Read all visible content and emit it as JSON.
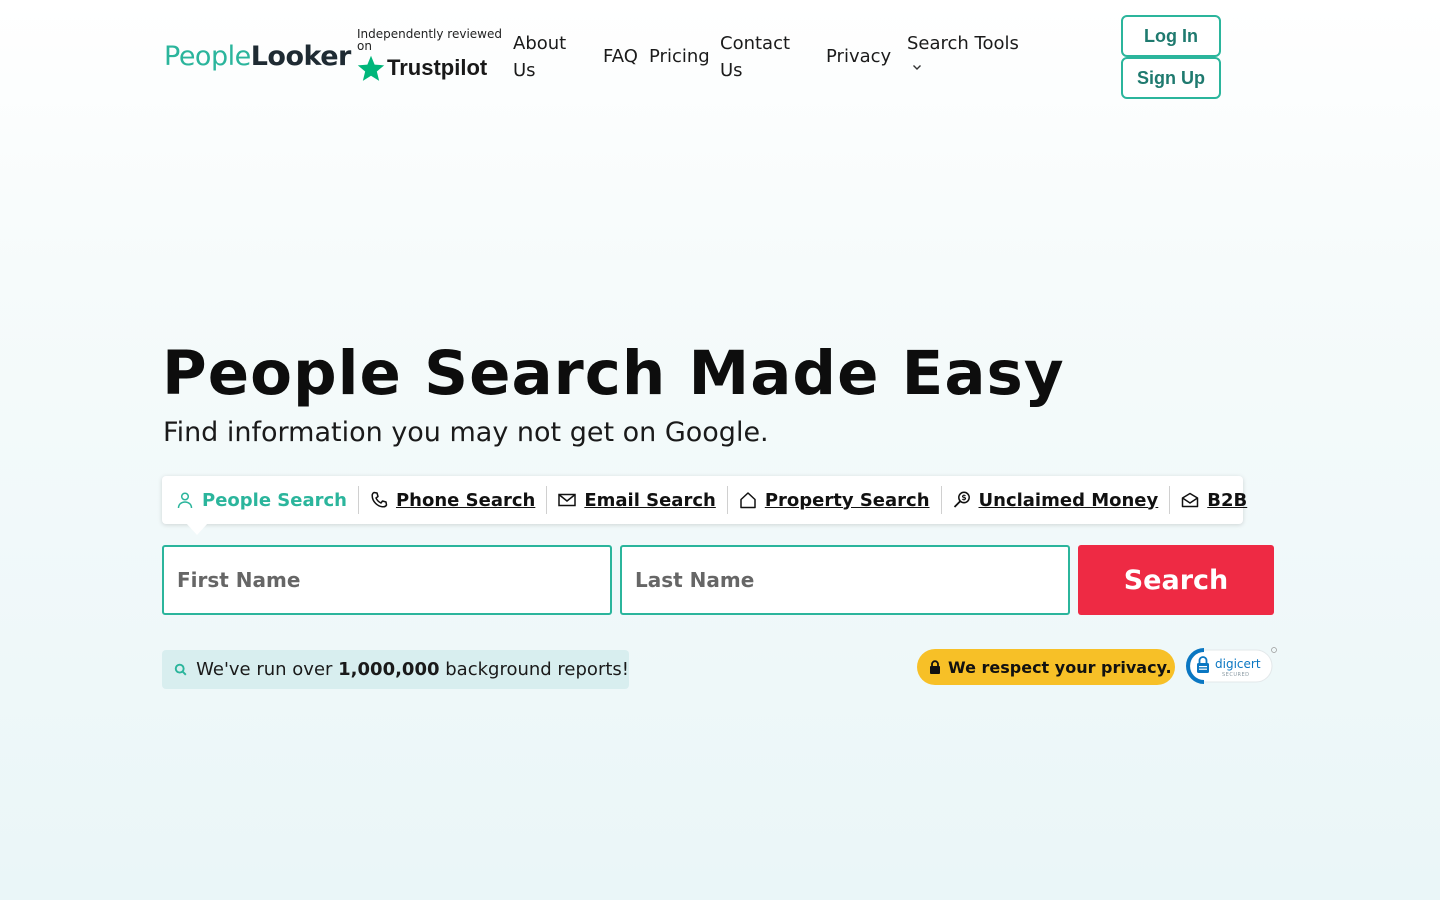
{
  "header": {
    "logo": {
      "part1": "People",
      "part2": "Looker"
    },
    "trustpilot": {
      "reviewed_text": "Independently reviewed on",
      "brand": "Trustpilot"
    },
    "nav": {
      "about": "About Us",
      "faq": "FAQ",
      "pricing": "Pricing",
      "contact": "Contact Us",
      "privacy": "Privacy",
      "search_tools": "Search Tools"
    },
    "login": "Log In",
    "signup": "Sign Up"
  },
  "hero": {
    "title": "People Search Made Easy",
    "subtitle": "Find information you may not get on Google."
  },
  "tabs": [
    {
      "label": "People Search",
      "icon": "person-icon",
      "active": true
    },
    {
      "label": "Phone Search",
      "icon": "phone-icon",
      "active": false
    },
    {
      "label": "Email Search",
      "icon": "envelope-icon",
      "active": false
    },
    {
      "label": "Property Search",
      "icon": "house-icon",
      "active": false
    },
    {
      "label": "Unclaimed Money",
      "icon": "money-search-icon",
      "active": false
    },
    {
      "label": "B2B",
      "icon": "open-envelope-icon",
      "active": false
    }
  ],
  "form": {
    "first_name_placeholder": "First Name",
    "last_name_placeholder": "Last Name",
    "search_button": "Search"
  },
  "stats": {
    "prefix": "We've run over ",
    "count": "1,000,000",
    "suffix": " background reports!"
  },
  "privacy_badge": "We respect your privacy.",
  "digicert": {
    "brand": "digicert",
    "secured": "SECURED"
  },
  "colors": {
    "brand_teal": "#2bb59c",
    "search_red": "#ee2a44",
    "privacy_yellow": "#f7c027",
    "trustpilot_green": "#00b67a",
    "digicert_blue": "#0a77c2"
  }
}
